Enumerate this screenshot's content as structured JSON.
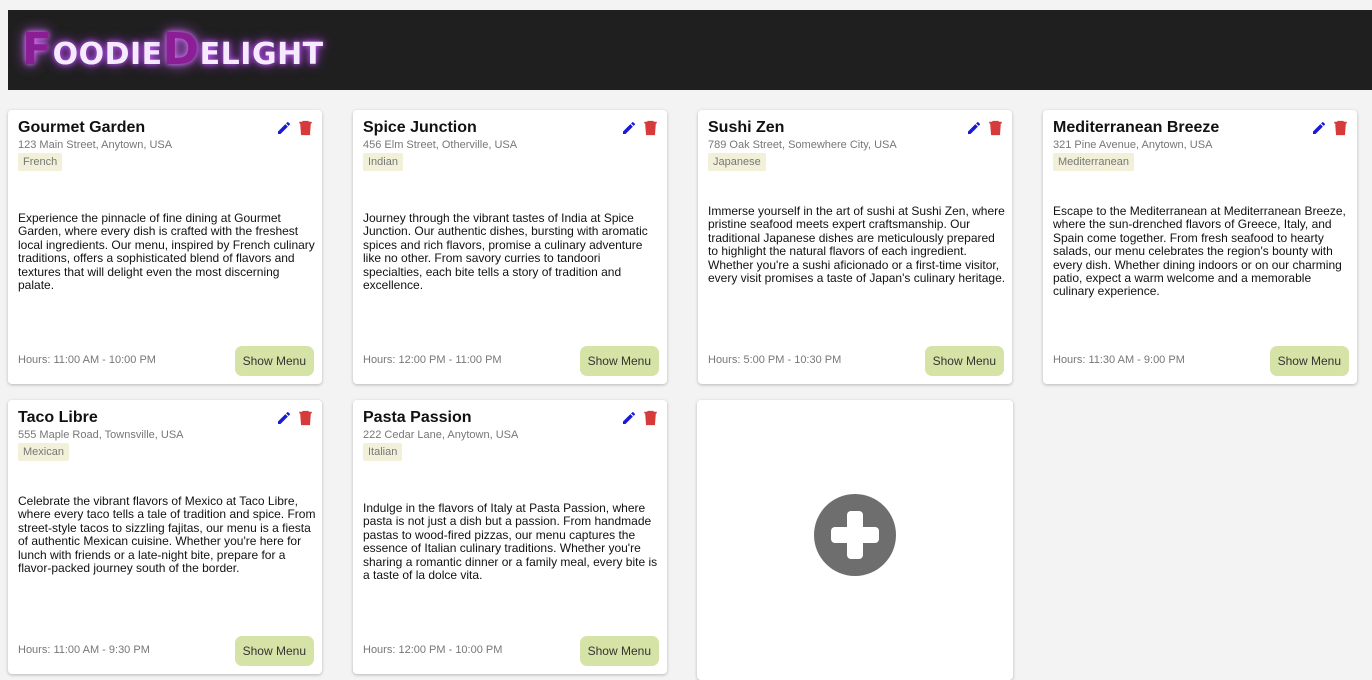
{
  "header": {
    "logo_first_big": "F",
    "logo_first_rest": "OODIE",
    "logo_second_big": "D",
    "logo_second_rest": "ELIGHT"
  },
  "colors": {
    "header_bg": "#1f1f1f",
    "logo_accent": "#8b1e94",
    "edit_icon": "#1a1ad6",
    "delete_icon": "#d63a3a",
    "menu_button_bg": "#d5e4a6",
    "add_icon": "#6e6e6e"
  },
  "icons": {
    "edit": "pencil-icon",
    "delete": "trash-icon",
    "add": "plus-circle-icon"
  },
  "restaurants": [
    {
      "name": "Gourmet Garden",
      "address": "123 Main Street, Anytown, USA",
      "cuisine": "French",
      "description": "Experience the pinnacle of fine dining at Gourmet Garden, where every dish is crafted with the freshest local ingredients. Our menu, inspired by French culinary traditions, offers a sophisticated blend of flavors and textures that will delight even the most discerning palate.",
      "hours": "Hours: 11:00 AM - 10:00 PM",
      "menu_label": "Show Menu"
    },
    {
      "name": "Spice Junction",
      "address": "456 Elm Street, Otherville, USA",
      "cuisine": "Indian",
      "description": "Journey through the vibrant tastes of India at Spice Junction. Our authentic dishes, bursting with aromatic spices and rich flavors, promise a culinary adventure like no other. From savory curries to tandoori specialties, each bite tells a story of tradition and excellence.",
      "hours": "Hours: 12:00 PM - 11:00 PM",
      "menu_label": "Show Menu"
    },
    {
      "name": "Sushi Zen",
      "address": "789 Oak Street, Somewhere City, USA",
      "cuisine": "Japanese",
      "description": "Immerse yourself in the art of sushi at Sushi Zen, where pristine seafood meets expert craftsmanship. Our traditional Japanese dishes are meticulously prepared to highlight the natural flavors of each ingredient. Whether you're a sushi aficionado or a first-time visitor, every visit promises a taste of Japan's culinary heritage.",
      "hours": "Hours: 5:00 PM - 10:30 PM",
      "menu_label": "Show Menu"
    },
    {
      "name": "Mediterranean Breeze",
      "address": "321 Pine Avenue, Anytown, USA",
      "cuisine": "Mediterranean",
      "description": "Escape to the Mediterranean at Mediterranean Breeze, where the sun-drenched flavors of Greece, Italy, and Spain come together. From fresh seafood to hearty salads, our menu celebrates the region's bounty with every dish. Whether dining indoors or on our charming patio, expect a warm welcome and a memorable culinary experience.",
      "hours": "Hours: 11:30 AM - 9:00 PM",
      "menu_label": "Show Menu"
    },
    {
      "name": "Taco Libre",
      "address": "555 Maple Road, Townsville, USA",
      "cuisine": "Mexican",
      "description": "Celebrate the vibrant flavors of Mexico at Taco Libre, where every taco tells a tale of tradition and spice. From street-style tacos to sizzling fajitas, our menu is a fiesta of authentic Mexican cuisine. Whether you're here for lunch with friends or a late-night bite, prepare for a flavor-packed journey south of the border.",
      "hours": "Hours: 11:00 AM - 9:30 PM",
      "menu_label": "Show Menu"
    },
    {
      "name": "Pasta Passion",
      "address": "222 Cedar Lane, Anytown, USA",
      "cuisine": "Italian",
      "description": "Indulge in the flavors of Italy at Pasta Passion, where pasta is not just a dish but a passion. From handmade pastas to wood-fired pizzas, our menu captures the essence of Italian culinary traditions. Whether you're sharing a romantic dinner or a family meal, every bite is a taste of la dolce vita.",
      "hours": "Hours: 12:00 PM - 10:00 PM",
      "menu_label": "Show Menu"
    }
  ]
}
